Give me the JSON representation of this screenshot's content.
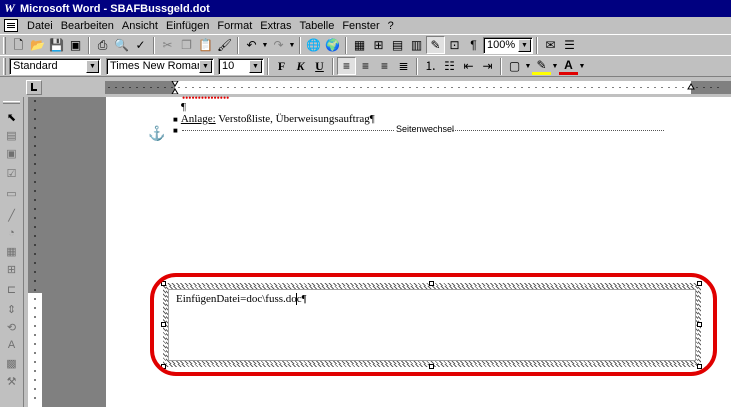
{
  "window": {
    "title": "Microsoft Word - SBAFBussgeld.dot",
    "app_icon": "word-icon"
  },
  "menubar": {
    "items": [
      {
        "label": "Datei"
      },
      {
        "label": "Bearbeiten"
      },
      {
        "label": "Ansicht"
      },
      {
        "label": "Einfügen"
      },
      {
        "label": "Format"
      },
      {
        "label": "Extras"
      },
      {
        "label": "Tabelle"
      },
      {
        "label": "Fenster"
      },
      {
        "label": "?"
      }
    ]
  },
  "toolbar_standard": {
    "zoom": "100%",
    "pilcrow": "¶"
  },
  "toolbar_format": {
    "style": "Standard",
    "font": "Times New Roman",
    "size": "10",
    "bold": "F",
    "italic": "K",
    "underline": "U",
    "font_color_letter": "A"
  },
  "colors": {
    "titlebar": "#000080",
    "highlight": "#e00000",
    "font_color": "#e00000",
    "highlighter": "#ffff00"
  },
  "document": {
    "red_fragment": "•••••••••••••••",
    "empty_para": "¶",
    "anlage_label": "Anlage:",
    "anlage_text": " Verstoßliste, Überweisungsauftrag¶",
    "page_break": "Seitenwechsel",
    "textbox_field": "EinfügenDatei=doc\\fuss.doc¶"
  }
}
